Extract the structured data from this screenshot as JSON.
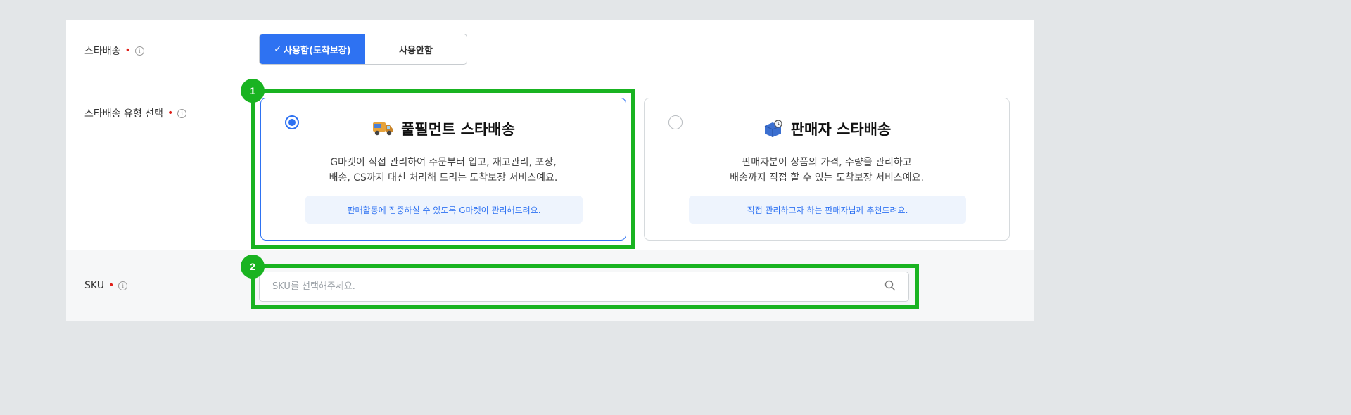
{
  "star_delivery": {
    "label": "스타배송",
    "options": [
      {
        "check": "✓",
        "label": "사용함(도착보장)",
        "selected": true
      },
      {
        "label": "사용안함",
        "selected": false
      }
    ]
  },
  "delivery_type": {
    "label": "스타배송 유형 선택",
    "cards": [
      {
        "title": "풀필먼트 스타배송",
        "icon": "delivery-truck-icon",
        "selected": true,
        "desc_line1": "G마켓이 직접 관리하여 주문부터 입고, 재고관리, 포장,",
        "desc_line2": "배송, CS까지 대신 처리해 드리는 도착보장 서비스예요.",
        "tip": "판매활동에 집중하실 수 있도록 G마켓이 관리해드려요."
      },
      {
        "title": "판매자 스타배송",
        "icon": "package-box-icon",
        "selected": false,
        "desc_line1": "판매자분이 상품의 가격, 수량을 관리하고",
        "desc_line2": "배송까지 직접 할 수 있는 도착보장 서비스예요.",
        "tip": "직접 관리하고자 하는 판매자님께 추천드려요."
      }
    ]
  },
  "sku": {
    "label": "SKU",
    "placeholder": "SKU를 선택해주세요.",
    "value": ""
  },
  "required_mark": "•",
  "info_mark": "i",
  "highlights": [
    {
      "number": "1"
    },
    {
      "number": "2"
    }
  ],
  "colors": {
    "accent": "#2e72f2",
    "highlight": "#19b321",
    "required": "#e0201a"
  }
}
